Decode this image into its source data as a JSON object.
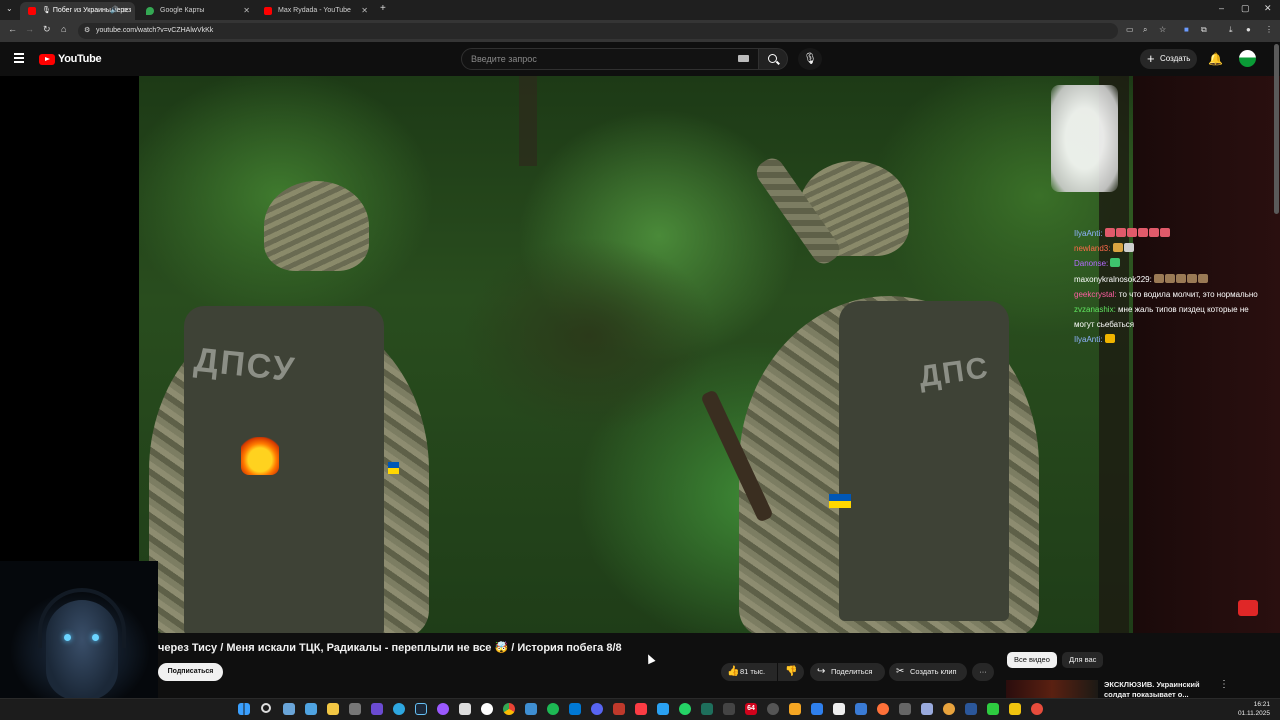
{
  "browser": {
    "tabs": [
      {
        "title": "🎙 Побег из Украины через",
        "active": true,
        "favicon_color": "#ff0000"
      },
      {
        "title": "Google Карты",
        "active": false,
        "favicon_color": "#34a853"
      },
      {
        "title": "Max Rydada - YouTube",
        "active": false,
        "favicon_color": "#ff0000"
      }
    ],
    "new_tab": "+",
    "url": "youtube.com/watch?v=vCZHAlwVkKk"
  },
  "youtube": {
    "logo": "YouTube",
    "search_placeholder": "Введите запрос",
    "create_label": "Создать"
  },
  "chat": [
    {
      "user": "IlyaAnti:",
      "user_color": "#8fb3ff",
      "message": "",
      "emotes": [
        "#e05a6a",
        "#e05a6a",
        "#e05a6a",
        "#e05a6a",
        "#e05a6a",
        "#e05a6a"
      ]
    },
    {
      "user": "newland3:",
      "user_color": "#ff6a4a",
      "message": "",
      "emotes": [
        "#d9a441",
        "#cfcfcf"
      ]
    },
    {
      "user": "Danonse:",
      "user_color": "#b46bff",
      "message": "",
      "emotes": [
        "#3ec46d"
      ]
    },
    {
      "user": "maxonykralnosok229:",
      "user_color": "#ffffff",
      "message": "",
      "emotes": [
        "#9a7a55",
        "#9a7a55",
        "#9a7a55",
        "#9a7a55",
        "#9a7a55"
      ]
    },
    {
      "user": "geekcrystal:",
      "user_color": "#ff5fa2",
      "message": "то что водила молчит, это нормально",
      "emotes": []
    },
    {
      "user": "zvzanashix:",
      "user_color": "#5fe35f",
      "message": "мне жаль типов пиздец которые не",
      "emotes": []
    },
    {
      "user": "",
      "user_color": "#ffffff",
      "message": "могут сьебаться",
      "emotes": []
    },
    {
      "user": "IlyaAnti:",
      "user_color": "#8fb3ff",
      "message": "",
      "emotes": [
        "#f0b400"
      ]
    }
  ],
  "video": {
    "vest_text": "ДПСУ",
    "vest_text_right": "ДПС",
    "title": "через Тису / Меня искали ТЦК, Радикалы - переплыли не все 🤯 / История побега 8/8"
  },
  "actions": {
    "subscribe": "Подписаться",
    "likes": "81 тыс.",
    "share": "Поделиться",
    "clip": "Создать клип",
    "more": "···"
  },
  "chips": [
    "Все видео",
    "Для вас"
  ],
  "recommendation": {
    "title": "ЭКСКЛЮЗИВ. Украинский солдат показывает о..."
  },
  "taskbar": {
    "badge": "64",
    "time": "16:21",
    "date": "01.11.2025"
  }
}
